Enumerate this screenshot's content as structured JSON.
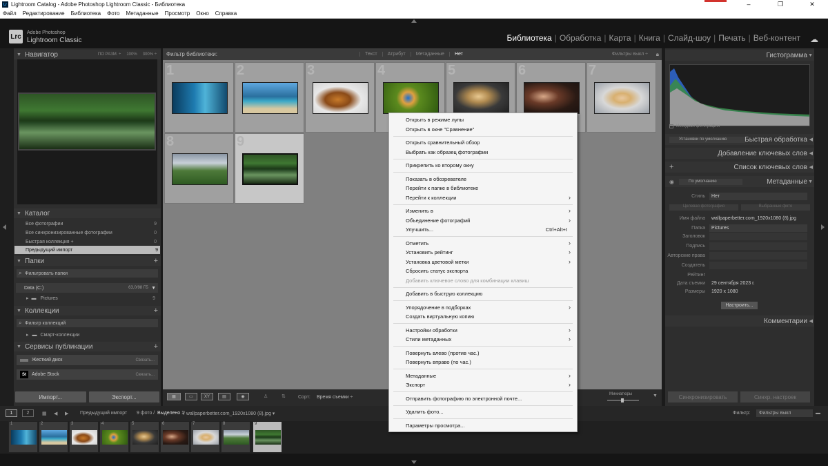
{
  "window": {
    "title": "Lightroom Catalog - Adobe Photoshop Lightroom Classic - Библиотека",
    "app_icon": "Lr",
    "controls": [
      "–",
      "❐",
      "✕"
    ]
  },
  "menu": [
    "Файл",
    "Редактирование",
    "Библиотека",
    "Фото",
    "Метаданные",
    "Просмотр",
    "Окно",
    "Справка"
  ],
  "identity": {
    "logo": "Lrc",
    "line1": "Adobe Photoshop",
    "line2": "Lightroom Classic"
  },
  "modules": [
    "Библиотека",
    "Обработка",
    "Карта",
    "Книга",
    "Слайд-шоу",
    "Печать",
    "Веб-контент"
  ],
  "active_module": "Библиотека",
  "navigator": {
    "title": "Навигатор",
    "opts": [
      "ПО РАЗМ. ÷",
      "100%",
      "300% ÷"
    ]
  },
  "catalog": {
    "title": "Каталог",
    "items": [
      {
        "label": "Все фотографии",
        "count": "9"
      },
      {
        "label": "Все синхронизированные фотографии",
        "count": "0"
      },
      {
        "label": "Быстрая коллекция +",
        "count": "0"
      },
      {
        "label": "Предыдущий импорт",
        "count": "9"
      }
    ]
  },
  "folders": {
    "title": "Папки",
    "filter": "Фильтровать папки",
    "drive": "Data (C:)",
    "drive_size": "63,0/98 ГБ",
    "folder": "Pictures",
    "folder_count": "9"
  },
  "collections": {
    "title": "Коллекции",
    "filter": "Фильтр коллекций",
    "item": "Смарт-коллекции"
  },
  "publish": {
    "title": "Сервисы публикации",
    "items": [
      {
        "label": "Жесткий диск",
        "action": "Связать..."
      },
      {
        "label": "Adobe Stock",
        "action": "Связать..."
      }
    ]
  },
  "left_buttons": {
    "import": "Импорт...",
    "export": "Экспорт..."
  },
  "filterbar": {
    "label": "Фильтр библиотеки:",
    "options": [
      "Текст",
      "Атрибут",
      "Метаданные",
      "Нет"
    ],
    "active": "Нет",
    "presets": "Фильтры выкл ÷"
  },
  "grid": {
    "cells": [
      {
        "num": "1"
      },
      {
        "num": "2"
      },
      {
        "num": "3"
      },
      {
        "num": "4"
      },
      {
        "num": "5"
      },
      {
        "num": "6"
      },
      {
        "num": "7"
      },
      {
        "num": "8"
      },
      {
        "num": "9"
      }
    ]
  },
  "toolbar": {
    "sort_label": "Сорт:",
    "sort_value": "Время съемки ÷",
    "thumbs": "Миниатюры"
  },
  "filmstrip_bar": {
    "p1": "1",
    "p2": "2",
    "source": "Предыдущий импорт",
    "info": "9 фото /",
    "selected": "Выделено 1",
    "file": "/ wallpaperbetter.com_1920x1080 (8).jpg ▾",
    "filter_label": "Фильтр:",
    "filter_value": "Фильтры выкл"
  },
  "filmstrip": {
    "cells": [
      "1",
      "2",
      "3",
      "4",
      "5",
      "6",
      "7",
      "8",
      "9"
    ]
  },
  "right": {
    "histogram": "Гистограмма",
    "original": "Исходная фотография",
    "quick": "Быстрая обработка",
    "quick_preset": "Установки по умолчанию",
    "keywording": "Добавление ключевых слов",
    "keyword_list": "Список ключевых слов",
    "metadata": "Метаданные",
    "meta_preset": "По умолчанию",
    "style_label": "Стиль",
    "style_value": "Нет",
    "tab1": "Целевая фотография",
    "tab2": "Выбранные фото",
    "fields": [
      {
        "k": "Имя файла",
        "v": "wallpaperbetter.com_1920x1080 (8).jpg"
      },
      {
        "k": "Папка",
        "v": "Pictures"
      },
      {
        "k": "Заголовок",
        "v": ""
      },
      {
        "k": "Подпись",
        "v": ""
      },
      {
        "k": "Авторские права",
        "v": ""
      },
      {
        "k": "Создатель",
        "v": ""
      },
      {
        "k": "Рейтинг",
        "v": ""
      },
      {
        "k": "Дата съемки",
        "v": "29 сентября 2023 г."
      },
      {
        "k": "Размеры",
        "v": "1920 x 1080"
      }
    ],
    "customize": "Настроить...",
    "comments": "Комментарии",
    "sync_meta": "Синхронизировать",
    "sync_settings": "Синхр. настроек"
  },
  "context_menu": [
    {
      "label": "Открыть в режиме лупы"
    },
    {
      "label": "Открыть в окне \"Сравнение\""
    },
    {
      "sep": true
    },
    {
      "label": "Открыть сравнительный обзор"
    },
    {
      "label": "Выбрать как образец фотографии"
    },
    {
      "sep": true
    },
    {
      "label": "Прикрепить ко второму окну"
    },
    {
      "sep": true
    },
    {
      "label": "Показать в обозревателе"
    },
    {
      "label": "Перейти к папке в библиотеке"
    },
    {
      "label": "Перейти к коллекции",
      "sub": true
    },
    {
      "sep": true
    },
    {
      "label": "Изменить в",
      "sub": true
    },
    {
      "label": "Объединение фотографий",
      "sub": true
    },
    {
      "label": "Улучшить...",
      "shortcut": "Ctrl+Alt+I"
    },
    {
      "sep": true
    },
    {
      "label": "Отметить",
      "sub": true
    },
    {
      "label": "Установить рейтинг",
      "sub": true
    },
    {
      "label": "Установка цветовой метки",
      "sub": true
    },
    {
      "label": "Сбросить статус экспорта"
    },
    {
      "label": "Добавить ключевое слово для комбинации клавиш",
      "disabled": true
    },
    {
      "sep": true
    },
    {
      "label": "Добавить в быструю коллекцию"
    },
    {
      "sep": true
    },
    {
      "label": "Упорядочение в подборках",
      "sub": true
    },
    {
      "label": "Создать виртуальную копию"
    },
    {
      "sep": true
    },
    {
      "label": "Настройки обработки",
      "sub": true
    },
    {
      "label": "Стили метаданных",
      "sub": true
    },
    {
      "sep": true
    },
    {
      "label": "Повернуть влево (против час.)"
    },
    {
      "label": "Повернуть вправо (по час.)"
    },
    {
      "sep": true
    },
    {
      "label": "Метаданные",
      "sub": true
    },
    {
      "label": "Экспорт",
      "sub": true
    },
    {
      "sep": true
    },
    {
      "label": "Отправить фотографию по электронной почте..."
    },
    {
      "sep": true
    },
    {
      "label": "Удалить фото..."
    },
    {
      "sep": true
    },
    {
      "label": "Параметры просмотра..."
    }
  ]
}
